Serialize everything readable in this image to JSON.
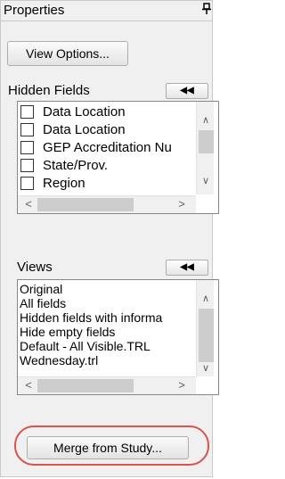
{
  "panel": {
    "title": "Properties",
    "pin_icon": "pin-icon",
    "view_options_label": "View Options..."
  },
  "hidden_fields": {
    "label": "Hidden Fields",
    "collapse_glyph": "◀◀",
    "items": [
      {
        "label": "Data Location",
        "checked": false
      },
      {
        "label": "Data Location",
        "checked": false
      },
      {
        "label": "GEP Accreditation Nu",
        "checked": false
      },
      {
        "label": "State/Prov.",
        "checked": false
      },
      {
        "label": "Region",
        "checked": false
      }
    ]
  },
  "views": {
    "label": "Views",
    "collapse_glyph": "◀◀",
    "items": [
      "Original",
      "All fields",
      "Hidden fields with informa",
      "Hide empty fields",
      "Default - All Visible.TRL",
      "Wednesday.trl"
    ]
  },
  "merge": {
    "label": "Merge from Study..."
  },
  "colors": {
    "panel_bg": "#f0f0f0",
    "highlight": "#d9534f"
  }
}
